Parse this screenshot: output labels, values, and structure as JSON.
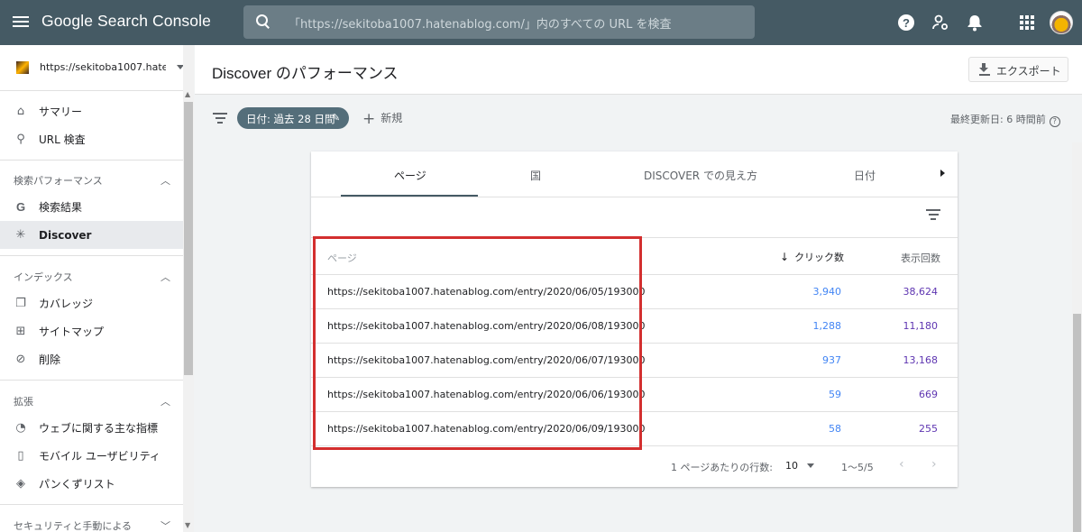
{
  "app": {
    "title": "Google Search Console",
    "search_placeholder": "「https://sekitoba1007.hatenablog.com/」内のすべての URL を検査"
  },
  "sidebar": {
    "property": "https://sekitoba1007.hatena...",
    "items_top": [
      {
        "label": "サマリー",
        "icon": "home-icon"
      },
      {
        "label": "URL 検査",
        "icon": "search-icon"
      }
    ],
    "sections": [
      {
        "title": "検索パフォーマンス",
        "items": [
          {
            "label": "検索結果",
            "icon": "google-icon"
          },
          {
            "label": "Discover",
            "icon": "asterisk-icon"
          }
        ]
      },
      {
        "title": "インデックス",
        "items": [
          {
            "label": "カバレッジ",
            "icon": "copy-icon"
          },
          {
            "label": "サイトマップ",
            "icon": "sitemap-icon"
          },
          {
            "label": "削除",
            "icon": "eye-off-icon"
          }
        ]
      },
      {
        "title": "拡張",
        "items": [
          {
            "label": "ウェブに関する主な指標",
            "icon": "gauge-icon"
          },
          {
            "label": "モバイル ユーザビリティ",
            "icon": "phone-icon"
          },
          {
            "label": "パンくずリスト",
            "icon": "layers-icon"
          }
        ]
      },
      {
        "title": "セキュリティと手動による"
      }
    ]
  },
  "header": {
    "title": "Discover のパフォーマンス",
    "export_label": "エクスポート"
  },
  "filters": {
    "date_chip": "日付: 過去 28 日間",
    "new_label": "新規",
    "last_updated": "最終更新日: 6 時間前"
  },
  "tabs": [
    "ページ",
    "国",
    "DISCOVER での見え方",
    "日付"
  ],
  "table": {
    "col_page": "ページ",
    "col_clicks": "クリック数",
    "col_impressions": "表示回数",
    "rows": [
      {
        "url": "https://sekitoba1007.hatenablog.com/entry/2020/06/05/193000",
        "clicks": "3,940",
        "impressions": "38,624"
      },
      {
        "url": "https://sekitoba1007.hatenablog.com/entry/2020/06/08/193000",
        "clicks": "1,288",
        "impressions": "11,180"
      },
      {
        "url": "https://sekitoba1007.hatenablog.com/entry/2020/06/07/193000",
        "clicks": "937",
        "impressions": "13,168"
      },
      {
        "url": "https://sekitoba1007.hatenablog.com/entry/2020/06/06/193000",
        "clicks": "59",
        "impressions": "669"
      },
      {
        "url": "https://sekitoba1007.hatenablog.com/entry/2020/06/09/193000",
        "clicks": "58",
        "impressions": "255"
      }
    ]
  },
  "pager": {
    "rows_label": "1 ページあたりの行数:",
    "rows_value": "10",
    "range": "1〜5/5"
  },
  "colors": {
    "topbar": "#455a64",
    "clicks": "#4285f4",
    "impressions": "#5e35b1",
    "highlight": "#d32f2f"
  }
}
